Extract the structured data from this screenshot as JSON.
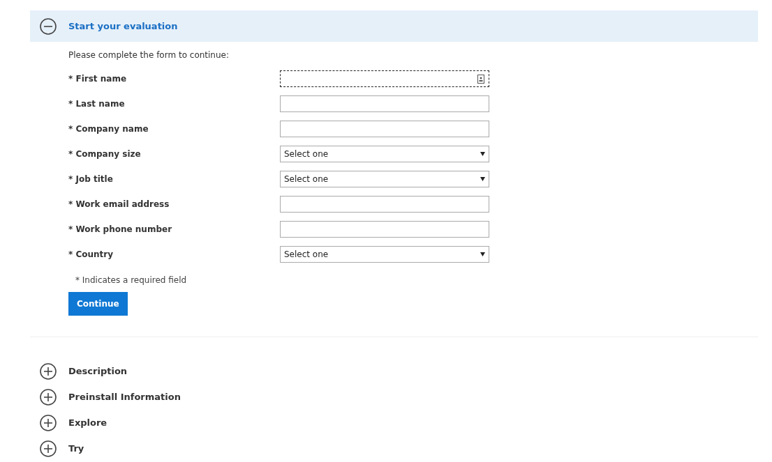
{
  "sections": [
    {
      "title": "Start your evaluation",
      "expanded": true,
      "intro": "Please complete the form to continue:",
      "fields": [
        {
          "label": "* First name",
          "kind": "text",
          "focused": true
        },
        {
          "label": "* Last name",
          "kind": "text",
          "focused": false
        },
        {
          "label": "* Company name",
          "kind": "text",
          "focused": false
        },
        {
          "label": "* Company size",
          "kind": "select",
          "value": "Select one",
          "focused": false
        },
        {
          "label": "* Job title",
          "kind": "select",
          "value": "Select one",
          "focused": false
        },
        {
          "label": "* Work email address",
          "kind": "text",
          "focused": false
        },
        {
          "label": "* Work phone number",
          "kind": "text",
          "focused": false
        },
        {
          "label": "* Country",
          "kind": "select",
          "value": "Select one",
          "focused": false
        }
      ],
      "required_note": "* Indicates a required field",
      "button": "Continue"
    },
    {
      "title": "Description",
      "expanded": false
    },
    {
      "title": "Preinstall Information",
      "expanded": false
    },
    {
      "title": "Explore",
      "expanded": false
    },
    {
      "title": "Try",
      "expanded": false
    }
  ]
}
